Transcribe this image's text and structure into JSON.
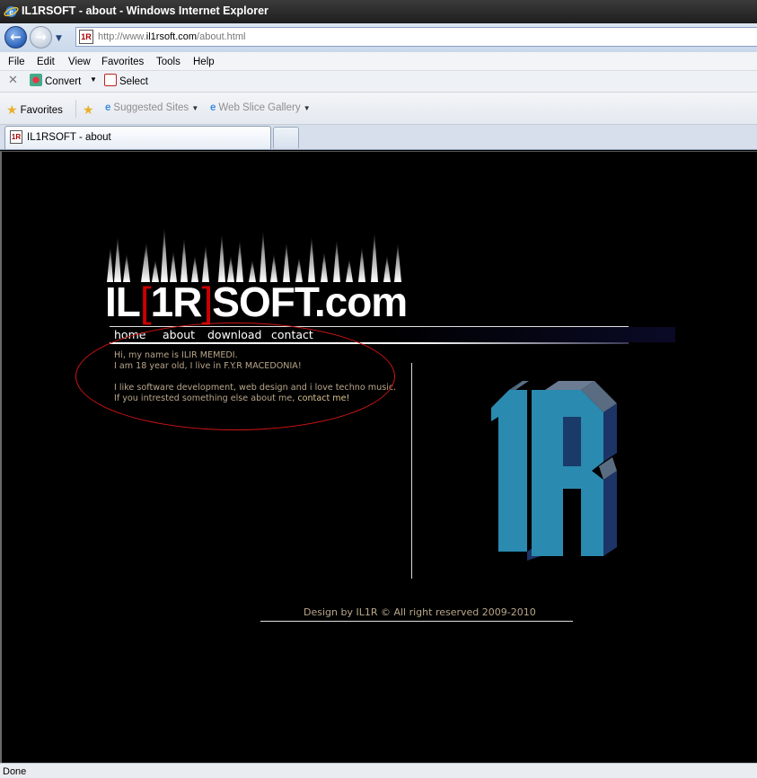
{
  "window": {
    "title": "IL1RSOFT - about - Windows Internet Explorer"
  },
  "address_bar": {
    "url_prefix": "http://www.",
    "url_domain": "il1rsoft.com",
    "url_path": "/about.html",
    "favicon_text": "1R"
  },
  "menu": [
    "File",
    "Edit",
    "View",
    "Favorites",
    "Tools",
    "Help"
  ],
  "command_bar": {
    "convert_label": "Convert",
    "select_label": "Select"
  },
  "favorites_bar": {
    "favorites_label": "Favorites",
    "suggested_sites_label": "Suggested Sites",
    "web_slice_label": "Web Slice Gallery"
  },
  "tabs": [
    {
      "label": "IL1RSOFT - about",
      "favicon_text": "1R"
    }
  ],
  "page": {
    "logo": {
      "part1": "IL",
      "bracket_open": "[",
      "part2": "1R",
      "bracket_close": "]",
      "part3": "SOFT.com"
    },
    "nav": [
      "home",
      "about",
      "download",
      "contact"
    ],
    "about_lines": [
      "Hi, my name is ILIR MEMEDI.",
      "I am 18 year old, I live in F.Y.R MACEDONIA!",
      "I like software development, web design and i love techno music.",
      "If you intrested something else about me, "
    ],
    "contact_link": "contact me!",
    "emblem_text": "1R",
    "footer": "Design by IL1R © All right reserved 2009-2010"
  },
  "status_bar": {
    "text": "Done"
  },
  "colors": {
    "page_bg": "#000000",
    "body_text": "#b8a68a",
    "annotation_ellipse": "#d01414",
    "emblem_face": "#2a8ab0",
    "emblem_side": "#1a3a6a"
  }
}
